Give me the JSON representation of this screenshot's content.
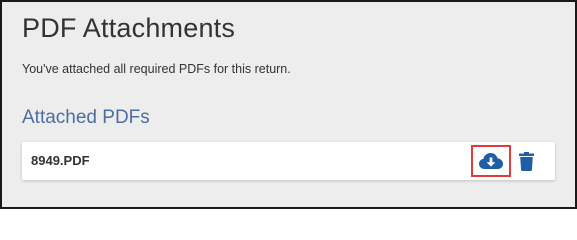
{
  "page": {
    "title": "PDF Attachments",
    "subtitle": "You've attached all required PDFs for this return."
  },
  "attached": {
    "heading": "Attached PDFs",
    "files": [
      {
        "name": "8949.PDF",
        "actions": {
          "download_icon": "cloud-download-icon",
          "delete_icon": "trash-icon"
        }
      }
    ]
  },
  "colors": {
    "page_background": "#ededed",
    "heading_accent": "#4a6fa1",
    "icon_blue": "#1f5fa8",
    "highlight_red": "#e03a3a",
    "text": "#333333"
  }
}
